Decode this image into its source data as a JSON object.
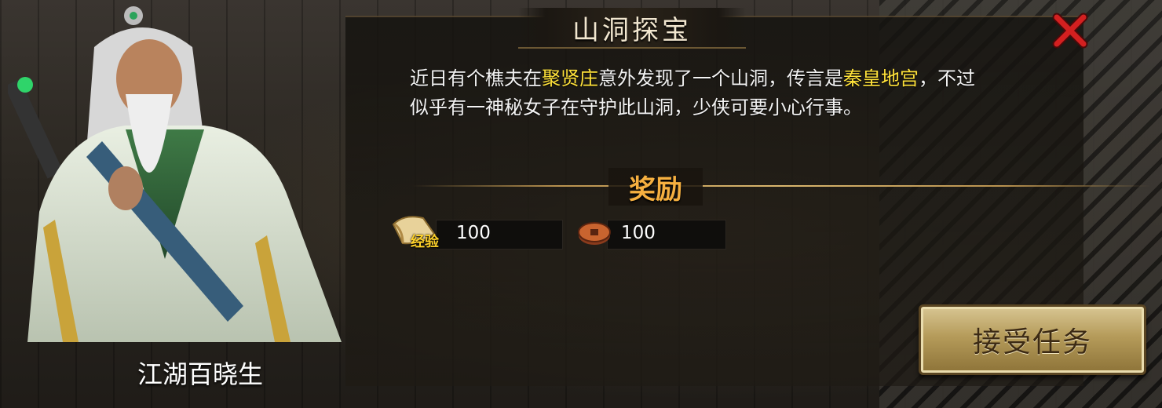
{
  "dialog": {
    "title": "山洞探宝",
    "description_parts": [
      "近日有个樵夫在",
      "聚贤庄",
      "意外发现了一个山洞，传言是",
      "秦皇地宫",
      "，不过似乎有一神秘女子在守护此山洞，少侠可要小心行事。"
    ],
    "reward_header": "奖励",
    "rewards": [
      {
        "icon": "scroll-icon",
        "label": "经验",
        "value": "100"
      },
      {
        "icon": "coin-icon",
        "value": "100"
      }
    ],
    "accept_button": "接受任务",
    "close_icon": "close-x-icon"
  },
  "npc": {
    "name": "江湖百晓生"
  },
  "colors": {
    "highlight": "#ffe23a",
    "reward_header": "#f6b040",
    "close": "#d32020"
  }
}
